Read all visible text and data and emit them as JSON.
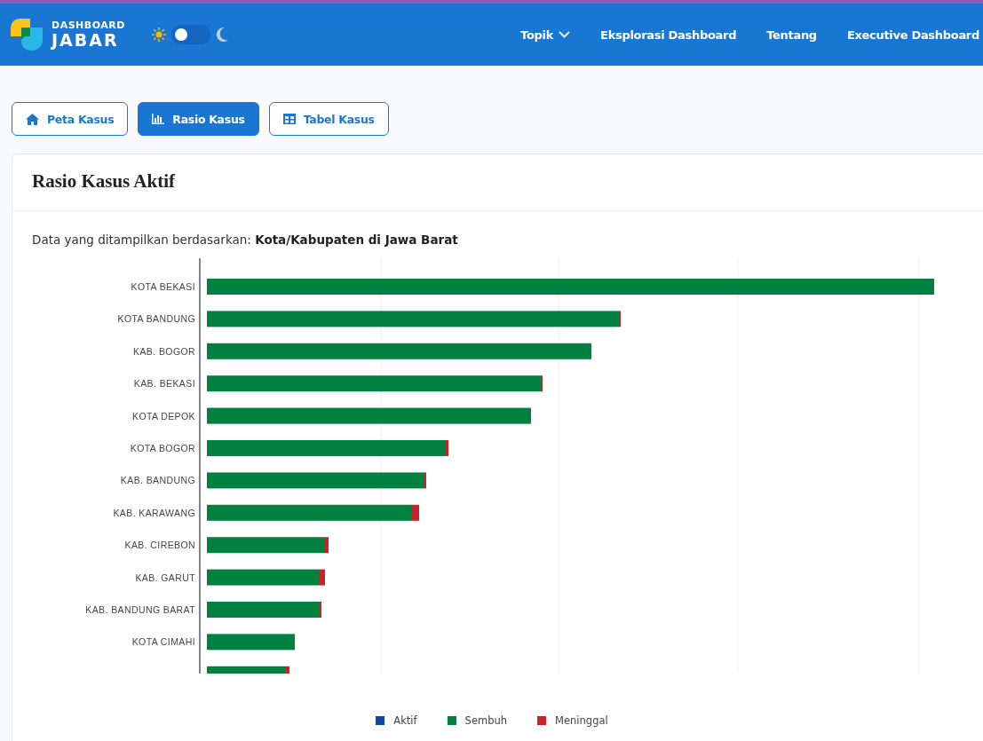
{
  "header": {
    "logo_top": "DASHBOARD",
    "logo_bottom": "JABAR",
    "dark_mode_toggle": {
      "on": false
    },
    "nav": [
      {
        "label": "Topik",
        "kind": "dropdown"
      },
      {
        "label": "Eksplorasi Dashboard",
        "kind": "link"
      },
      {
        "label": "Tentang",
        "kind": "link"
      },
      {
        "label": "Executive Dashboard",
        "kind": "link"
      }
    ]
  },
  "tabs": [
    {
      "label": "Peta Kasus",
      "kind": "home",
      "selected": false
    },
    {
      "label": "Rasio Kasus",
      "kind": "chart",
      "selected": true
    },
    {
      "label": "Tabel Kasus",
      "kind": "table",
      "selected": false
    }
  ],
  "card": {
    "title": "Rasio Kasus Aktif",
    "subtitle": "Data yang ditampilkan berdasarkan: **Kota/Kabupaten di Jawa Barat**",
    "chart": {
      "categories": [
        "KOTA BEKASI",
        "KOTA BANDUNG",
        "KAB. BOGOR",
        "KAB. BEKASI",
        "KOTA DEPOK",
        "KOTA BOGOR",
        "KAB. BANDUNG",
        "KAB. KARAWANG",
        "KAB. CIREBON",
        "KAB. GARUT",
        "KAB. BANDUNG BARAT",
        "KOTA CIMAHI"
      ],
      "legend": [
        {
          "label": "Aktif",
          "color": "#0d47a1"
        },
        {
          "label": "Sembuh",
          "color": "#008140"
        },
        {
          "label": "Meninggal",
          "color": "#cb2227"
        }
      ]
    }
  }
}
